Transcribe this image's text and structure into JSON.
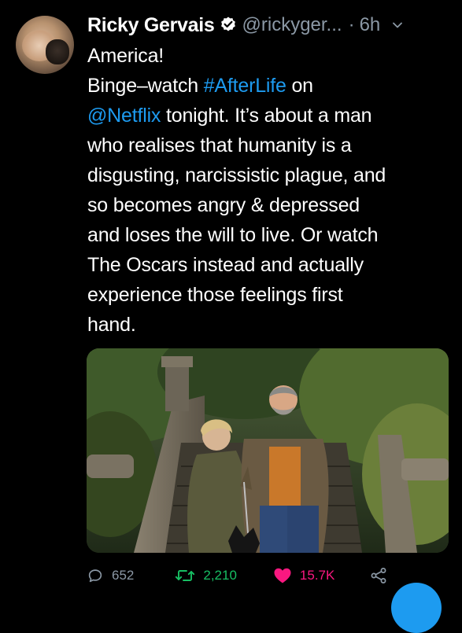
{
  "tweet": {
    "author_name": "Ricky Gervais",
    "handle": "@rickyger...",
    "separator": "·",
    "time": "6h",
    "body_lines": [
      [
        "America!"
      ],
      [
        "Binge–watch ",
        "#AfterLife",
        " on"
      ],
      [
        "@Netflix",
        " tonight. It’s about a man"
      ],
      [
        "who realises that humanity is a"
      ],
      [
        "disgusting, narcissistic plague, and"
      ],
      [
        "so becomes angry & depressed"
      ],
      [
        "and loses the will to live. Or watch"
      ],
      [
        "The Oscars instead and actually"
      ],
      [
        "experience those feelings first"
      ],
      [
        "hand."
      ]
    ],
    "hashtag": "#AfterLife",
    "mention": "@Netflix"
  },
  "actions": {
    "reply_count": "652",
    "retweet_count": "2,210",
    "like_count": "15.7K"
  },
  "icons": {
    "verified": "verified-badge-icon",
    "chevron": "chevron-down-icon",
    "reply": "reply-bubble-icon",
    "retweet": "retweet-icon",
    "like": "heart-icon",
    "share": "share-icon",
    "compose": "compose-fab-icon"
  },
  "colors": {
    "background": "#000000",
    "text": "#ffffff",
    "muted": "#8b98a5",
    "link": "#1d9bf0",
    "retweet": "#17bf63",
    "like": "#f91880"
  }
}
